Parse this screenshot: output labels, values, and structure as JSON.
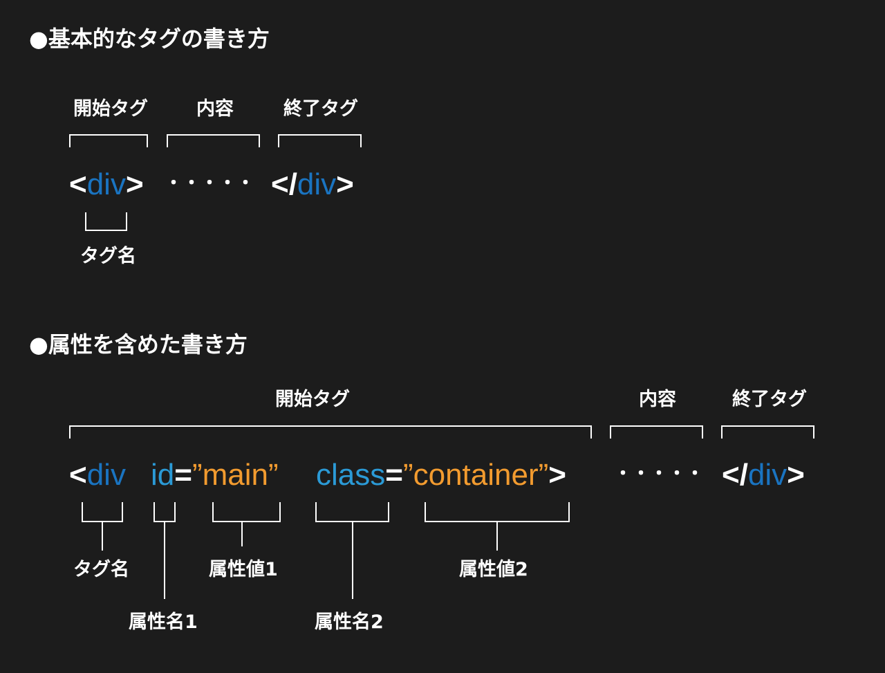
{
  "section1": {
    "heading": "●基本的なタグの書き方",
    "labels": {
      "start_tag": "開始タグ",
      "content": "内容",
      "end_tag": "終了タグ",
      "tag_name": "タグ名"
    },
    "code": {
      "open_lt": "<",
      "open_tag": "div",
      "open_gt": ">",
      "dots": "・・・・・",
      "close_lt": "</",
      "close_tag": "div",
      "close_gt": ">"
    }
  },
  "section2": {
    "heading": "●属性を含めた書き方",
    "labels": {
      "start_tag": "開始タグ",
      "content": "内容",
      "end_tag": "終了タグ",
      "tag_name": "タグ名",
      "attr_name1": "属性名1",
      "attr_value1": "属性値1",
      "attr_name2": "属性名2",
      "attr_value2": "属性値2"
    },
    "code": {
      "open_lt": "<",
      "open_tag": "div",
      "attr1": "id",
      "eq1": "=",
      "val1": "”main”",
      "attr2": "class",
      "eq2": "=",
      "val2": "”container”",
      "open_gt": ">",
      "dots": "・・・・・",
      "close_lt": "</",
      "close_tag": "div",
      "close_gt": ">"
    }
  },
  "colors": {
    "background": "#1c1c1c",
    "text": "#ffffff",
    "tag_name": "#1a74c1",
    "attribute_name": "#2b9ad6",
    "attribute_value": "#f29b2f"
  }
}
